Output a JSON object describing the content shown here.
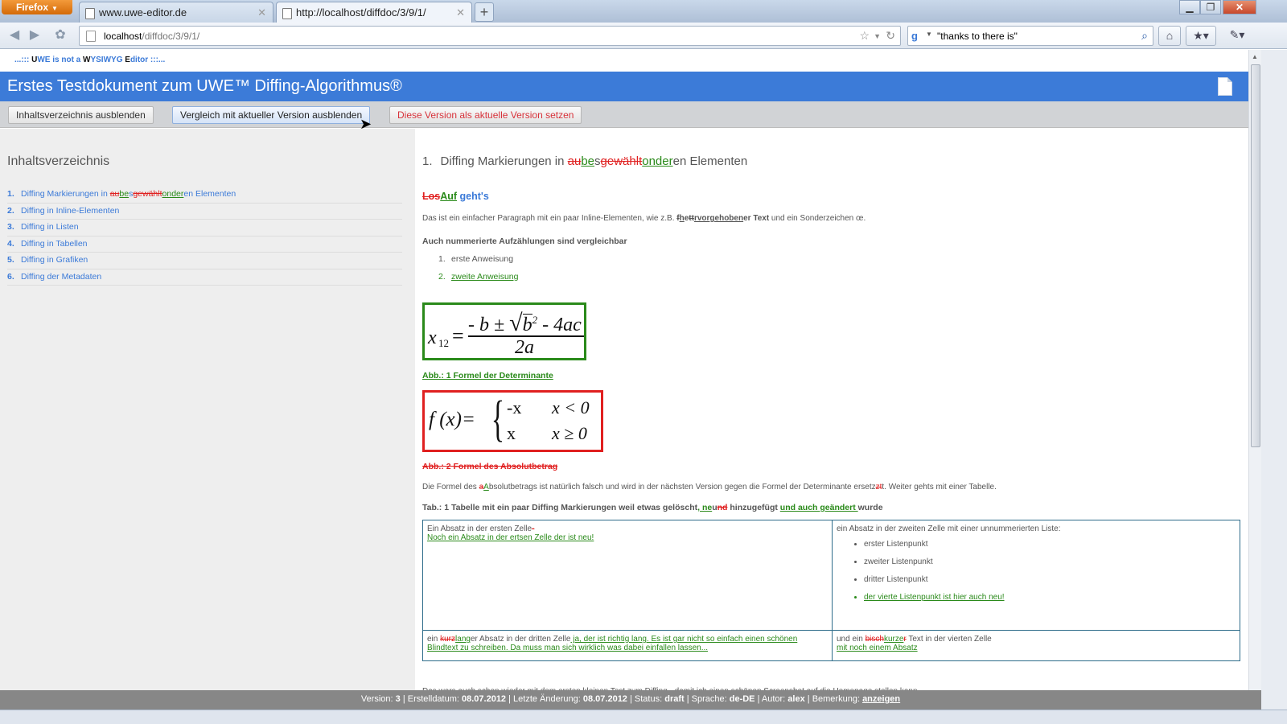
{
  "browser": {
    "app_button": "Firefox",
    "tabs": [
      {
        "title": "www.uwe-editor.de"
      },
      {
        "title": "http://localhost/diffdoc/3/9/1/"
      }
    ],
    "url_host": "localhost",
    "url_path": "/diffdoc/3/9/1/",
    "search_query": "\"thanks to there is\""
  },
  "page": {
    "slogan_prefix": "...::: ",
    "slogan_u": "U",
    "slogan_1": "WE is not a ",
    "slogan_w": "W",
    "slogan_2": "YSIWYG ",
    "slogan_e": "E",
    "slogan_3": "ditor :::...",
    "title": "Erstes Testdokument zum UWE™ Diffing-Algorithmus®",
    "buttons": {
      "toc_toggle": "Inhaltsverzeichnis ausblenden",
      "compare_toggle": "Vergleich mit aktueller Version ausblenden",
      "set_current": "Diese Version als aktuelle Version setzen"
    },
    "toc_heading": "Inhaltsverzeichnis",
    "toc": [
      {
        "num": "1.",
        "pre": "Diffing Markierungen in ",
        "d1": "au",
        "i1": "be",
        "s1": "s",
        "d2": "gewählt",
        "i2": "onder",
        "post": "en Elementen"
      },
      {
        "num": "2.",
        "text": "Diffing in Inline-Elementen"
      },
      {
        "num": "3.",
        "text": "Diffing in Listen"
      },
      {
        "num": "4.",
        "text": "Diffing in Tabellen"
      },
      {
        "num": "5.",
        "text": "Diffing in Grafiken"
      },
      {
        "num": "6.",
        "text": "Diffing der Metadaten"
      }
    ],
    "h1": {
      "num": "1.",
      "pre": "Diffing Markierungen in ",
      "d1": "au",
      "i1": "be",
      "s1": "s",
      "d2": "gewählt",
      "i2": "onder",
      "post": "en Elementen"
    },
    "h2": {
      "del": "Los",
      "ins": "Auf",
      "post": " geht's"
    },
    "p1": {
      "pre": "Das ist ein einfacher Paragraph mit ein paar Inline-Elementen, wie z.B. ",
      "d1": "f",
      "i1": "h",
      "s1": "e",
      "d2": "tt",
      "i2": "rvorgehoben",
      "s2": "er Text",
      "post": " und ein Sonderzeichen œ."
    },
    "h3": "Auch nummerierte Aufzählungen sind vergleichbar",
    "list": [
      {
        "num": "1.",
        "text": "erste Anweisung"
      },
      {
        "num": "2.",
        "text": "zweite Anweisung"
      }
    ],
    "formula1": {
      "lhs": "x",
      "sub": "12",
      "num": "- b ± ",
      "root": "b",
      "sup": "2",
      "root_rest": " - 4ac",
      "den": "2a"
    },
    "caption1": "Abb.: 1 Formel der Determinante",
    "formula2": {
      "lhs": "f (x)=",
      "r1a": "-x",
      "r1b": "x < 0",
      "r2a": "x",
      "r2b": "x ≥ 0"
    },
    "caption2": "Abb.: 2 Formel des Absolutbetrag",
    "p2": {
      "pre": "Die Formel des ",
      "d1": "a",
      "i1": "A",
      "mid": "bsolutbetrags ist natürlich falsch und wird in der nächsten Version gegen die Formel der Determinante ersetz",
      "d2": "zt",
      "post": "t. Weiter gehts mit einer Tabelle."
    },
    "table_caption": {
      "pre": "Tab.: 1 Tabelle mit ein paar Diffing Markierungen weil etwas gelöscht",
      "i1": ", ne",
      "s1": "u",
      "d1": "nd",
      "mid": " hinzugefügt ",
      "i2": "und auch geändert ",
      "post": "wurde"
    },
    "table": {
      "c1_text": "Ein Absatz in der ersten Zelle",
      "c1_del": "-",
      "c1_ins": "Noch ein Absatz in der ertsen Zelle der ist neu!",
      "c2_text": "ein Absatz in der zweiten Zelle mit einer unnummerierten Liste:",
      "c2_items": [
        "erster Listenpunkt",
        "zweiter Listenpunkt",
        "dritter Listenpunkt"
      ],
      "c2_new_item": "der vierte Listenpunkt ist hier auch neu!",
      "c3_pre": "ein ",
      "c3_del": "kurz",
      "c3_ins": "lang",
      "c3_mid": "er Absatz in der dritten Zelle",
      "c3_ins2": " ja, der ist richtig lang. Es ist gar nicht so einfach einen schönen Blindtext zu schreiben. Da muss man sich wirklich was dabei einfallen lassen...",
      "c4_pre": "und ein ",
      "c4_del": "bisch",
      "c4_ins": "kurze",
      "c4_del2": "r",
      "c4_post": " Text in der vierten Zelle",
      "c4_ins_para": "mit noch einem Absatz"
    },
    "p_end": "Das wars auch schon wieder mit dem ersten kleinen Test zum Diffing - damit ich einen schönen Screenshot auf die Homepage stellen kann.",
    "status": {
      "version_label": "Version: ",
      "version": "3",
      "created_label": " | Erstelldatum: ",
      "created": "08.07.2012",
      "changed_label": " | Letzte Änderung: ",
      "changed": "08.07.2012",
      "status_label": " | Status: ",
      "status": "draft",
      "lang_label": " | Sprache: ",
      "lang": "de-DE",
      "author_label": " | Autor: ",
      "author": "alex",
      "remark_label": " | Bemerkung: ",
      "remark_link": "anzeigen"
    }
  },
  "colors": {
    "header_blue": "#3c7bd8",
    "inserted": "#2a8a1a",
    "deleted": "#e02020",
    "sidebar_bg": "#eeeeee"
  }
}
